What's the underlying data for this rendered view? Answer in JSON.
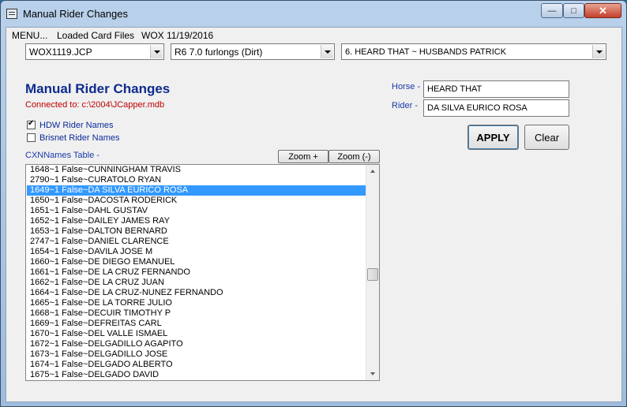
{
  "window": {
    "title": "Manual Rider Changes"
  },
  "menu": {
    "items": [
      "MENU...",
      "Loaded Card Files",
      "WOX 11/19/2016"
    ]
  },
  "selectors": {
    "card": "WOX1119.JCP",
    "race": "R6 7.0 furlongs (Dirt)",
    "horse": "6. HEARD THAT ~ HUSBANDS PATRICK"
  },
  "heading": "Manual Rider Changes",
  "connected": "Connected to: c:\\2004\\JCapper.mdb",
  "options": {
    "hdw": {
      "label": "HDW Rider Names",
      "checked": true
    },
    "brisnet": {
      "label": "Brisnet Rider Names",
      "checked": false
    }
  },
  "form": {
    "horse_label": "Horse -",
    "horse_value": "HEARD THAT",
    "rider_label": "Rider -",
    "rider_value": "DA SILVA EURICO ROSA",
    "apply_label": "APPLY",
    "clear_label": "Clear"
  },
  "table": {
    "label": "CXNNames Table -",
    "zoom_in": "Zoom +",
    "zoom_out": "Zoom (-)",
    "selected_index": 2,
    "rows": [
      "1648~1 False~CUNNINGHAM TRAVIS",
      "2790~1 False~CURATOLO RYAN",
      "1649~1 False~DA SILVA EURICO ROSA",
      "1650~1 False~DACOSTA RODERICK",
      "1651~1 False~DAHL GUSTAV",
      "1652~1 False~DAILEY JAMES RAY",
      "1653~1 False~DALTON BERNARD",
      "2747~1 False~DANIEL CLARENCE",
      "1654~1 False~DAVILA JOSE M",
      "1660~1 False~DE DIEGO EMANUEL",
      "1661~1 False~DE LA CRUZ FERNANDO",
      "1662~1 False~DE LA CRUZ JUAN",
      "1664~1 False~DE LA CRUZ-NUNEZ FERNANDO",
      "1665~1 False~DE LA TORRE JULIO",
      "1668~1 False~DECUIR TIMOTHY P",
      "1669~1 False~DEFREITAS CARL",
      "1670~1 False~DEL VALLE ISMAEL",
      "1672~1 False~DELGADILLO AGAPITO",
      "1673~1 False~DELGADILLO JOSE",
      "1674~1 False~DELGADO ALBERTO",
      "1675~1 False~DELGADO DAVID"
    ]
  }
}
